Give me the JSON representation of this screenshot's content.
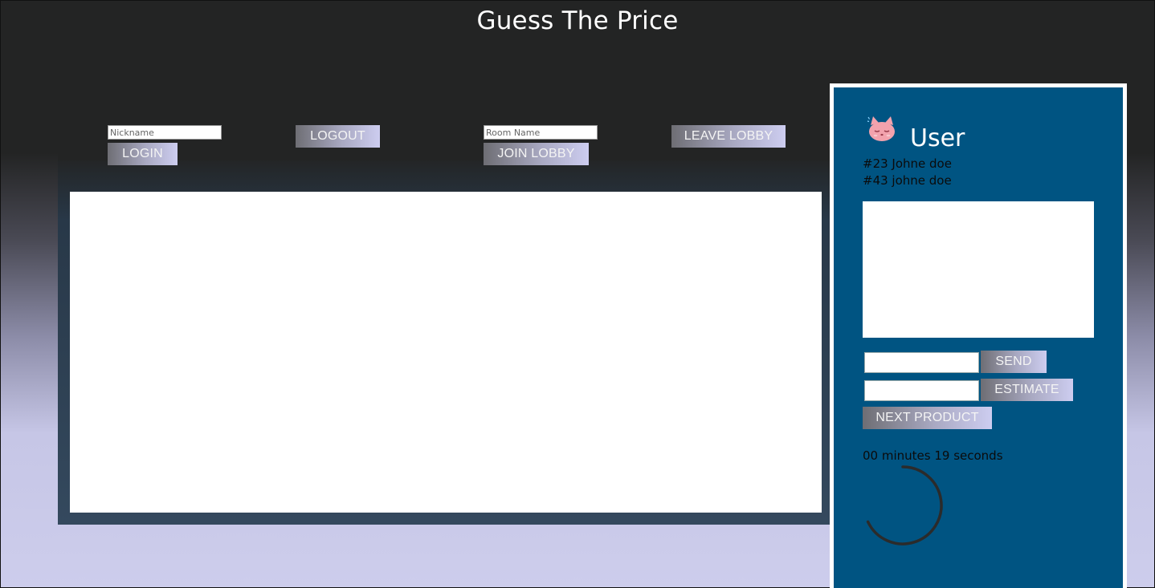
{
  "app": {
    "title": "Guess The Price"
  },
  "auth": {
    "nickname_placeholder": "Nickname",
    "nickname_value": "",
    "login_label": "LOGIN",
    "logout_label": "LOGOUT"
  },
  "lobby": {
    "room_placeholder": "Room Name",
    "room_value": "",
    "join_label": "JOIN LOBBY",
    "leave_label": "LEAVE LOBBY"
  },
  "sidebar": {
    "avatar_icon": "cat-avatar-icon",
    "user_label": "User",
    "players": [
      {
        "entry": "#23 Johne doe"
      },
      {
        "entry": "#43 johne doe"
      }
    ],
    "chat_value": "",
    "estimate_value": "",
    "send_label": "SEND",
    "estimate_label": "ESTIMATE",
    "next_label": "NEXT PRODUCT",
    "timer_text": "00 minutes 19 seconds",
    "timer_progress": 0.68
  },
  "colors": {
    "background_dark": "#232424",
    "background_light": "#cdcdec",
    "board_bottom": "#34495e",
    "sidebar_blue": "#005482",
    "canvas": "#ffffff",
    "spinner": "#2b2b2b"
  }
}
